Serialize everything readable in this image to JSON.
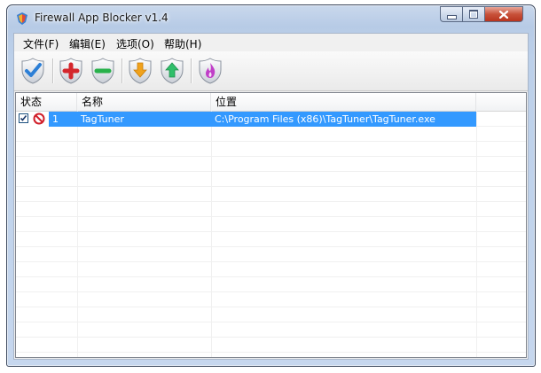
{
  "window": {
    "title": "Firewall App Blocker v1.4"
  },
  "menu": [
    {
      "label": "文件(F)"
    },
    {
      "label": "编辑(E)"
    },
    {
      "label": "选项(O)"
    },
    {
      "label": "帮助(H)"
    }
  ],
  "toolbar": [
    {
      "icon": "checkmark-shield-icon",
      "color": "#2c7fd6"
    },
    {
      "icon": "add-shield-icon",
      "color": "#d4262c"
    },
    {
      "icon": "remove-shield-icon",
      "color": "#27b14a"
    },
    {
      "icon": "import-shield-icon",
      "color": "#f0a21c"
    },
    {
      "icon": "export-shield-icon",
      "color": "#2fbf6a"
    },
    {
      "icon": "flame-shield-icon",
      "color": "#c03fc8"
    }
  ],
  "list": {
    "columns": [
      "状态",
      "名称",
      "位置"
    ],
    "rows": [
      {
        "index": "1",
        "checked": true,
        "status": "blocked",
        "name": "TagTuner",
        "path": "C:\\Program Files (x86)\\TagTuner\\TagTuner.exe"
      }
    ]
  },
  "colors": {
    "selection": "#3399ff",
    "close_button": "#c8523a"
  }
}
